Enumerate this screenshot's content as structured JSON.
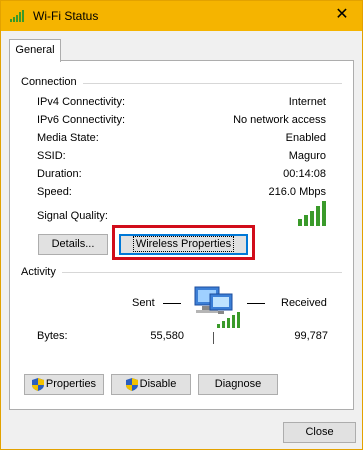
{
  "window": {
    "title": "Wi-Fi Status",
    "close_glyph": "✕"
  },
  "tabs": [
    {
      "label": "General"
    }
  ],
  "connection": {
    "group_title": "Connection",
    "rows": [
      {
        "label": "IPv4 Connectivity:",
        "value": "Internet"
      },
      {
        "label": "IPv6 Connectivity:",
        "value": "No network access"
      },
      {
        "label": "Media State:",
        "value": "Enabled"
      },
      {
        "label": "SSID:",
        "value": "Maguro"
      },
      {
        "label": "Duration:",
        "value": "00:14:08"
      },
      {
        "label": "Speed:",
        "value": "216.0 Mbps"
      }
    ],
    "signal_label": "Signal Quality:",
    "signal_bars": 5,
    "signal_icon": "signal-bars-icon",
    "details_button": "Details...",
    "wireless_button": "Wireless Properties"
  },
  "activity": {
    "group_title": "Activity",
    "sent_label": "Sent",
    "received_label": "Received",
    "bytes_label": "Bytes:",
    "bytes_sent": "55,580",
    "bytes_received": "99,787",
    "network_icon": "network-computer-icon"
  },
  "buttons": {
    "properties": "Properties",
    "disable": "Disable",
    "diagnose": "Diagnose",
    "close": "Close"
  },
  "colors": {
    "titlebar": "#f5b400",
    "highlight": "#d10d1a",
    "signal": "#3a9a2a"
  }
}
